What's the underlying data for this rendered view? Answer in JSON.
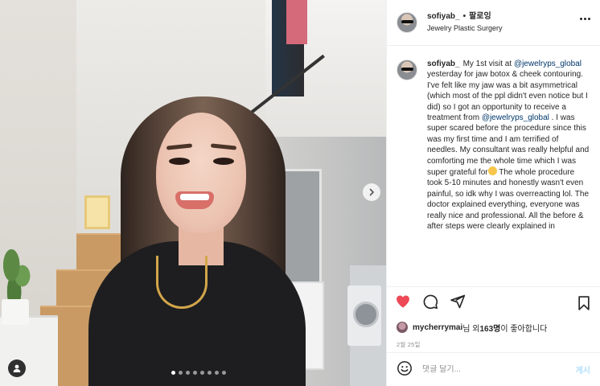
{
  "header": {
    "username": "sofiyab_",
    "follow_label": "팔로잉",
    "location": "Jewelry Plastic Surgery"
  },
  "caption": {
    "username": "sofiyab_",
    "text_1": "My 1st visit at ",
    "mention_1": "@jewelryps_global",
    "text_2": " yesterday for jaw botox & cheek contouring. I've felt like my jaw was a bit asymmetrical (which most of the ppl didn't even notice but I did) so I got an opportunity to receive a treatment from ",
    "mention_2": "@jewelryps_global",
    "text_3": " . I was super scared before the procedure since this was my first time and I am terrified of needles. My consultant was really helpful and comforting me the whole time which I was super grateful for",
    "text_4": " The whole procedure took 5-10 minutes and honestly wasn't even painful, so idk why I was overreacting lol. The doctor explained everything, everyone was really nice and professional. All the before & after steps were clearly explained in"
  },
  "likes": {
    "liker": "mycherrymai",
    "text_mid": "님 외 ",
    "count": "163명",
    "text_end": "이 좋아합니다"
  },
  "date": "2월 25일",
  "comment": {
    "placeholder": "댓글 달기...",
    "post_label": "게시"
  },
  "carousel": {
    "slide_count": 8,
    "active_index": 0
  },
  "colors": {
    "like_red": "#ed4956",
    "link_blue": "#00376b",
    "post_disabled": "#b2dffc"
  }
}
